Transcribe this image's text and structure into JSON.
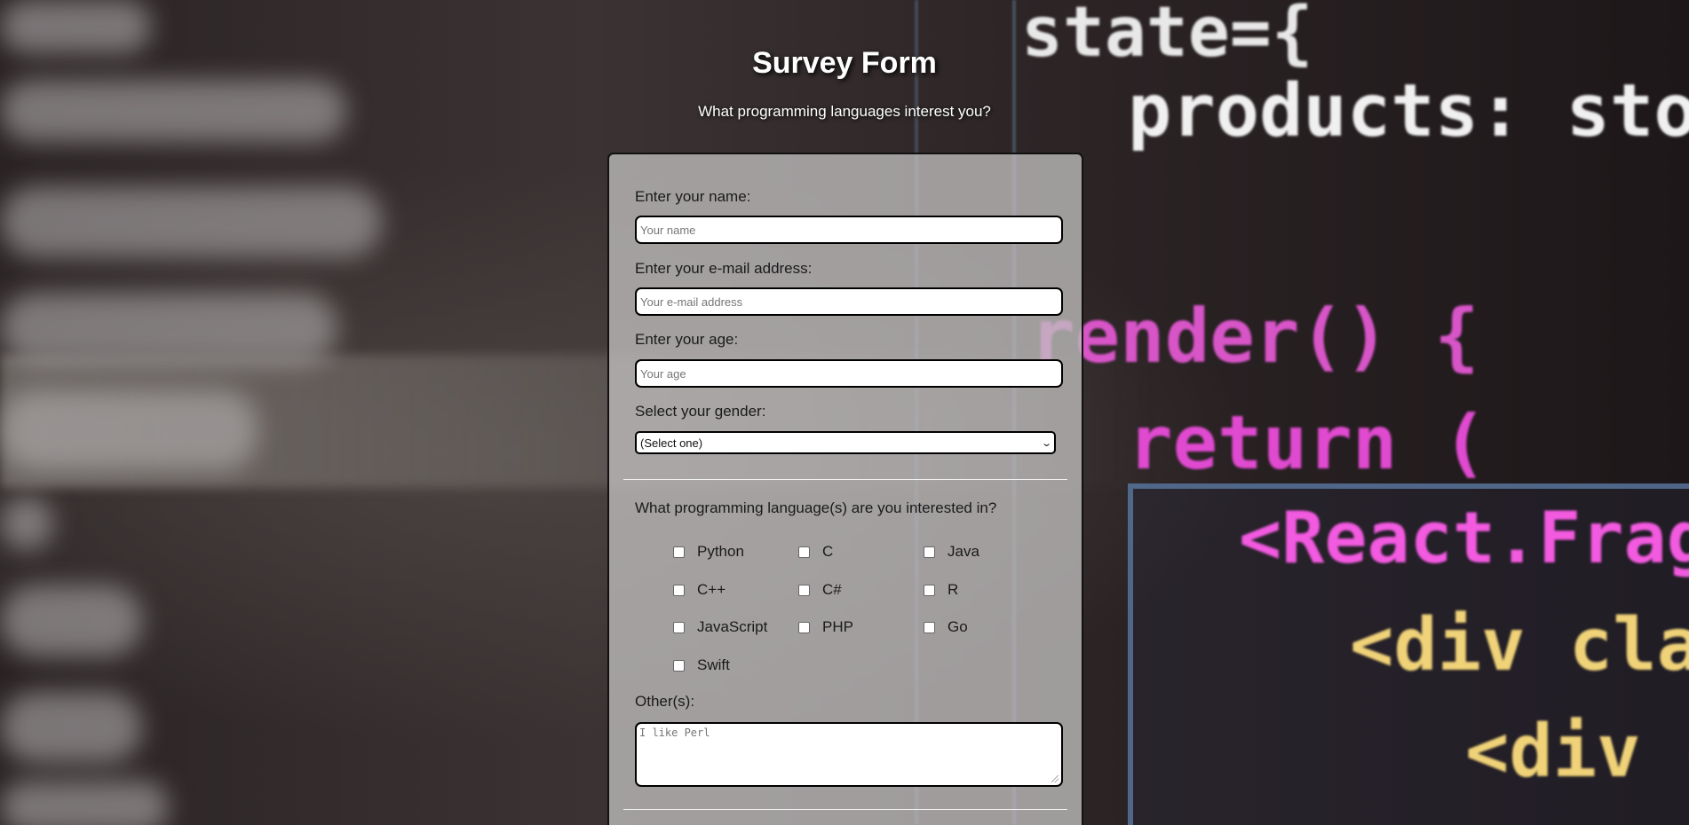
{
  "page": {
    "title": "Survey Form",
    "subtitle": "What programming languages interest you?"
  },
  "form": {
    "name": {
      "label": "Enter your name:",
      "placeholder": "Your name",
      "value": ""
    },
    "email": {
      "label": "Enter your e-mail address:",
      "placeholder": "Your e-mail address",
      "value": ""
    },
    "age": {
      "label": "Enter your age:",
      "placeholder": "Your age",
      "value": ""
    },
    "gender": {
      "label": "Select your gender:",
      "selected": "(Select one)"
    },
    "languages": {
      "question": "What programming language(s) are you interested in?",
      "options": [
        {
          "label": "Python",
          "checked": false
        },
        {
          "label": "C",
          "checked": false
        },
        {
          "label": "Java",
          "checked": false
        },
        {
          "label": "C++",
          "checked": false
        },
        {
          "label": "C#",
          "checked": false
        },
        {
          "label": "R",
          "checked": false
        },
        {
          "label": "JavaScript",
          "checked": false
        },
        {
          "label": "PHP",
          "checked": false
        },
        {
          "label": "Go",
          "checked": false
        },
        {
          "label": "Swift",
          "checked": false
        }
      ]
    },
    "others": {
      "label": "Other(s):",
      "placeholder": "I like Perl"
    }
  },
  "background": {
    "code_lines": [
      "state={",
      "products: storeProd",
      "render() {",
      "return (",
      "<React.Fragment>",
      "<div classNa",
      "<div cla"
    ]
  }
}
